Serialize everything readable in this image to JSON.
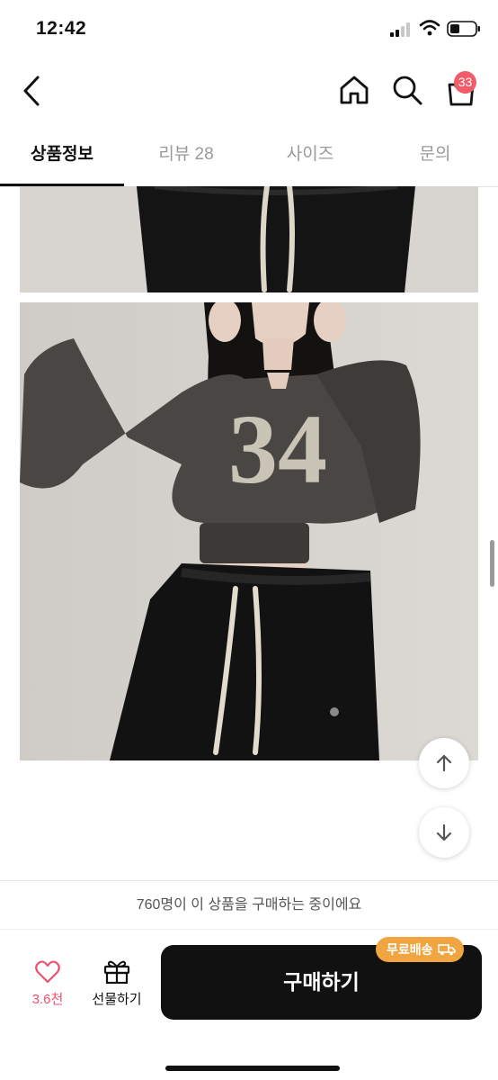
{
  "status_bar": {
    "time": "12:42"
  },
  "header": {
    "cart_count": "33"
  },
  "tabs": [
    {
      "label": "상품정보",
      "active": true
    },
    {
      "label": "리뷰 28",
      "active": false
    },
    {
      "label": "사이즈",
      "active": false
    },
    {
      "label": "문의",
      "active": false
    }
  ],
  "product_image": {
    "print_text": "34"
  },
  "notice": {
    "text": "760명이 이 상품을 구매하는 중이에요"
  },
  "bottom_bar": {
    "like_count": "3.6천",
    "gift_label": "선물하기",
    "buy_label": "구매하기",
    "free_shipping_badge": "무료배송"
  },
  "colors": {
    "accent_pink": "#f0506e",
    "cart_badge": "#f25b6a",
    "free_shipping": "#f0a540",
    "buy_button": "#111111"
  },
  "icons": [
    "back-icon",
    "home-icon",
    "search-icon",
    "cart-icon",
    "arrow-up-icon",
    "arrow-down-icon",
    "heart-icon",
    "gift-icon",
    "truck-icon"
  ]
}
